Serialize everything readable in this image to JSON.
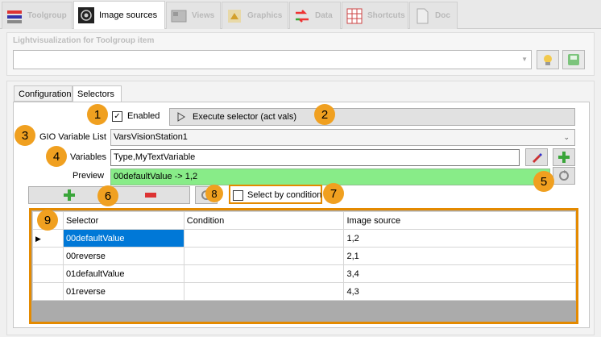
{
  "top_tabs": [
    {
      "label": "Toolgroup",
      "icon": "toolgroup-icon"
    },
    {
      "label": "Image sources",
      "icon": "image-sources-icon"
    },
    {
      "label": "Views",
      "icon": "views-icon"
    },
    {
      "label": "Graphics",
      "icon": "graphics-icon"
    },
    {
      "label": "Data",
      "icon": "data-icon"
    },
    {
      "label": "Shortcuts",
      "icon": "shortcuts-icon"
    },
    {
      "label": "Doc",
      "icon": "doc-icon"
    }
  ],
  "group": {
    "title": "Lightvisualization for Toolgroup item",
    "combo_value": ""
  },
  "tabs": [
    "Configuration",
    "Selectors"
  ],
  "selectors": {
    "enabled_label": "Enabled",
    "enabled_checked": true,
    "execute_label": "Execute selector (act vals)",
    "gio_label": "GIO Variable List",
    "gio_value": "VarsVisionStation1",
    "variables_label": "Variables",
    "variables_value": "Type,MyTextVariable",
    "preview_label": "Preview",
    "preview_value": "00defaultValue -> 1,2",
    "select_by_condition_label": "Select by condition",
    "select_by_condition_checked": false
  },
  "grid": {
    "columns": [
      "Selector",
      "Condition",
      "Image source"
    ],
    "rows": [
      {
        "selector": "00defaultValue",
        "condition": "",
        "image_source": "1,2"
      },
      {
        "selector": "00reverse",
        "condition": "",
        "image_source": "2,1"
      },
      {
        "selector": "01defaultValue",
        "condition": "",
        "image_source": "3,4"
      },
      {
        "selector": "01reverse",
        "condition": "",
        "image_source": "4,3"
      }
    ],
    "selected_row": 0
  },
  "badges": [
    "1",
    "2",
    "3",
    "4",
    "5",
    "6",
    "7",
    "8",
    "9"
  ],
  "colors": {
    "accent": "#e48a00",
    "preview_bg": "#88ec88",
    "selection": "#0078d7"
  }
}
